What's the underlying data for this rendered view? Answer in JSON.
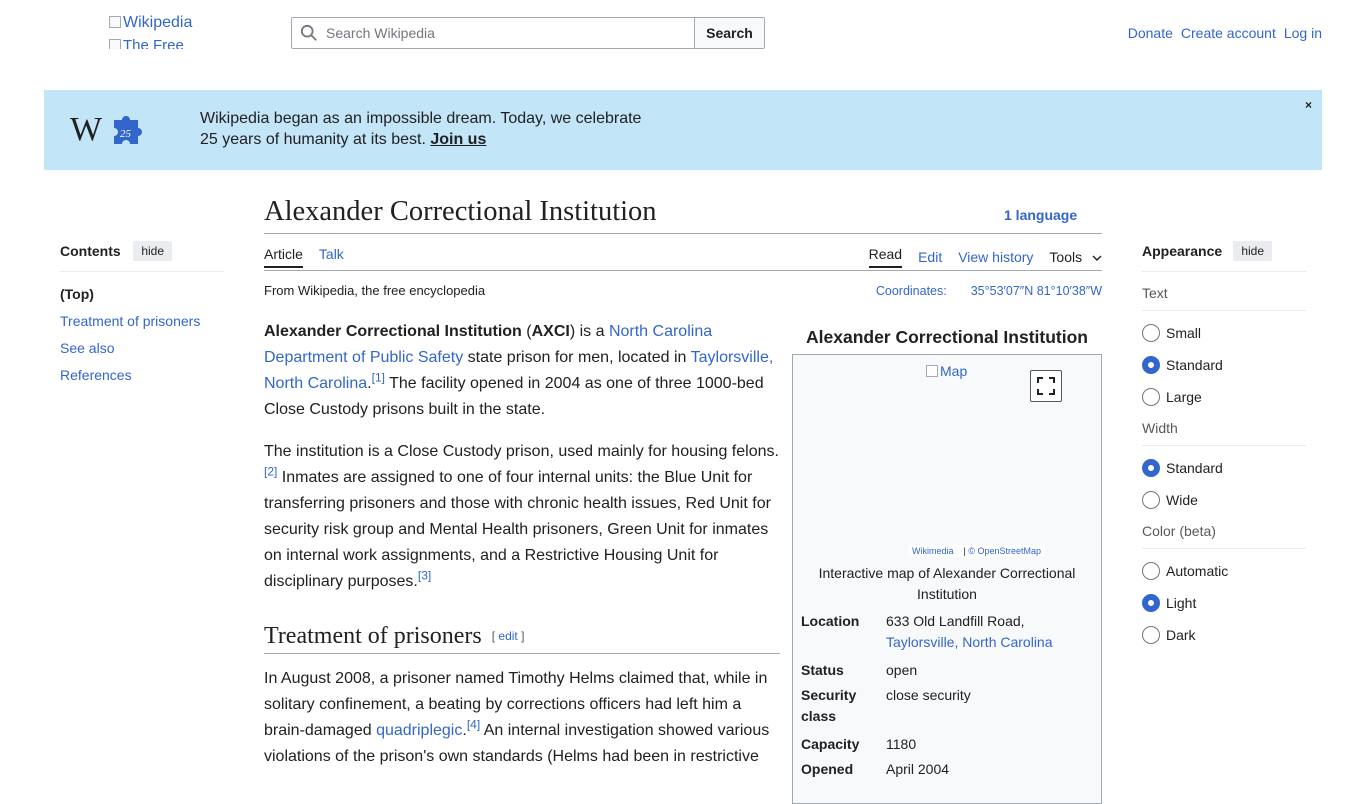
{
  "header": {
    "logo_alt_1": "Wikipedia",
    "logo_alt_2": "The Free",
    "search_placeholder": "Search Wikipedia",
    "search_button": "Search",
    "links": [
      "Donate",
      "Create account",
      "Log in"
    ]
  },
  "banner": {
    "line1": "Wikipedia began as an impossible dream. Today, we celebrate",
    "line2_prefix": "25 years of humanity at its best.",
    "join": "Join us",
    "close": "×",
    "logo_number": "25"
  },
  "toc": {
    "title": "Contents",
    "hide": "hide",
    "items": [
      "(Top)",
      "Treatment of prisoners",
      "See also",
      "References"
    ]
  },
  "article": {
    "title": "Alexander Correctional Institution",
    "language": "1 language",
    "tabs_left": [
      "Article",
      "Talk"
    ],
    "tabs_right": [
      "Read",
      "Edit",
      "View history",
      "Tools"
    ],
    "from": "From Wikipedia, the free encyclopedia",
    "coords_label": "Coordinates:",
    "coords_value": "35°53′07″N 81°10′38″W",
    "p1": {
      "bold1": "Alexander Correctional Institution",
      "t1": " (",
      "bold2": "AXCI",
      "t2": ") is a ",
      "link1": "North Carolina Department of Public Safety",
      "t3": " state prison for men, located in ",
      "link2": "Taylorsville, North Carolina",
      "t4": ".",
      "ref1": "[1]",
      "t5": " The facility opened in 2004 as one of three 1000-bed Close Custody prisons built in the state."
    },
    "p2": {
      "t1": "The institution is a Close Custody prison, used mainly for housing felons.",
      "ref1": "[2]",
      "t2": " Inmates are assigned to one of four internal units: the Blue Unit for transferring prisoners and those with chronic health issues, Red Unit for security risk group and Mental Health prisoners, Green Unit for inmates on internal work assignments, and a Restrictive Housing Unit for disciplinary purposes.",
      "ref2": "[3]"
    },
    "h2": "Treatment of prisoners",
    "h2_edit": "[ edit ]",
    "p3": {
      "t1": "In August 2008, a prisoner named Timothy Helms claimed that, while in solitary confinement, a beating by corrections officers had left him a brain-damaged ",
      "link1": "quadriplegic",
      "t2": ".",
      "ref1": "[4]",
      "t3": " An internal investigation showed various violations of the prison's own standards (Helms had been in restrictive"
    }
  },
  "infobox": {
    "title": "Alexander Correctional Institution",
    "map_alt": "Map",
    "attrib1": "Wikimedia",
    "attrib2": "© OpenStreetMap",
    "caption": "Interactive map of Alexander Correctional Institution",
    "rows": [
      {
        "k": "Location",
        "v": "633 Old Landfill Road,",
        "v_link": "Taylorsville, North Carolina"
      },
      {
        "k": "Status",
        "v": "open"
      },
      {
        "k": "Security class",
        "v": "close security"
      },
      {
        "k": "Capacity",
        "v": "1180"
      },
      {
        "k": "Opened",
        "v": "April 2004"
      }
    ]
  },
  "appearance": {
    "title": "Appearance",
    "hide": "hide",
    "groups": [
      {
        "label": "Text",
        "options": [
          "Small",
          "Standard",
          "Large"
        ],
        "selected": 1
      },
      {
        "label": "Width",
        "options": [
          "Standard",
          "Wide"
        ],
        "selected": 0
      },
      {
        "label": "Color (beta)",
        "options": [
          "Automatic",
          "Light",
          "Dark"
        ],
        "selected": 1
      }
    ]
  },
  "colors": {
    "link": "#3366cc",
    "banner_bg": "#c3e5f8",
    "text": "#202122"
  }
}
